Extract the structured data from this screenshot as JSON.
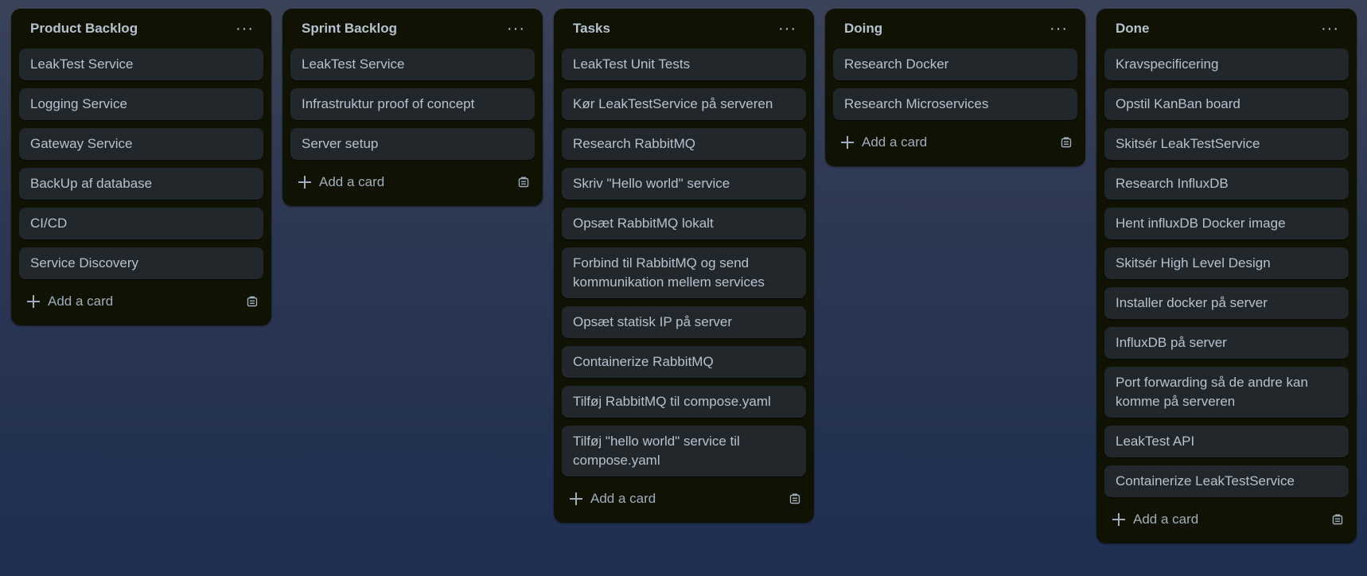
{
  "board": {
    "lists": [
      {
        "title": "Product Backlog",
        "menu_label": "···",
        "add_label": "Add a card",
        "cards": [
          "LeakTest Service",
          "Logging Service",
          "Gateway Service",
          "BackUp af database",
          "CI/CD",
          "Service Discovery"
        ]
      },
      {
        "title": "Sprint Backlog",
        "menu_label": "···",
        "add_label": "Add a card",
        "cards": [
          "LeakTest Service",
          "Infrastruktur proof of concept",
          "Server setup"
        ]
      },
      {
        "title": "Tasks",
        "menu_label": "···",
        "add_label": "Add a card",
        "cards": [
          "LeakTest Unit Tests",
          "Kør LeakTestService på serveren",
          "Research RabbitMQ",
          "Skriv \"Hello world\" service",
          "Opsæt RabbitMQ lokalt",
          "Forbind til RabbitMQ og send kommunikation mellem services",
          "Opsæt statisk IP på server",
          "Containerize RabbitMQ",
          "Tilføj RabbitMQ til compose.yaml",
          "Tilføj \"hello world\" service til compose.yaml"
        ]
      },
      {
        "title": "Doing",
        "menu_label": "···",
        "add_label": "Add a card",
        "cards": [
          "Research Docker",
          "Research Microservices"
        ]
      },
      {
        "title": "Done",
        "menu_label": "···",
        "add_label": "Add a card",
        "cards": [
          "Kravspecificering",
          "Opstil KanBan board",
          "Skitsér LeakTestService",
          "Research InfluxDB",
          "Hent influxDB Docker image",
          "Skitsér High Level Design",
          "Installer docker på server",
          "InfluxDB på server",
          "Port forwarding så de andre kan komme på serveren",
          "LeakTest API",
          "Containerize LeakTestService"
        ]
      }
    ]
  },
  "icons": {
    "menu": "more-horizontal-icon",
    "add": "plus-icon",
    "template": "card-template-icon"
  },
  "colors": {
    "list_background": "#101204",
    "card_background": "#22272b",
    "text": "#b6c2cf",
    "subtle_text": "#9fadbc"
  }
}
